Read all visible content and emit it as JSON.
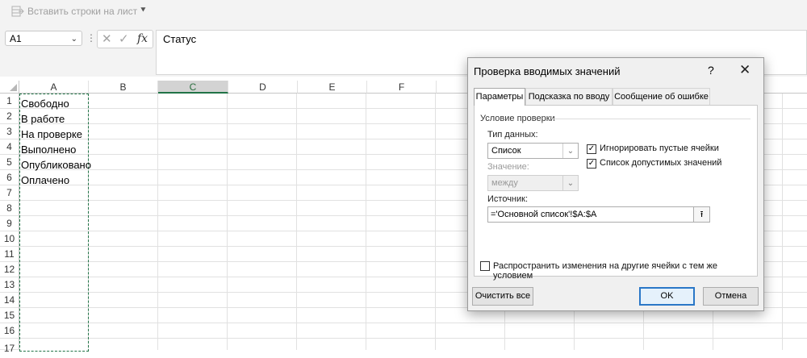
{
  "ribbon": {
    "insert_rows_label": "Вставить строки на лист",
    "more_icon": "chevron-down-icon"
  },
  "formula_bar": {
    "name_box": "A1",
    "cancel_icon": "✕",
    "enter_icon": "✓",
    "fx_label": "fx",
    "formula": "Статус"
  },
  "columns": [
    "A",
    "B",
    "C",
    "D",
    "E",
    "F"
  ],
  "selected_column": "C",
  "rows": [
    "1",
    "2",
    "3",
    "4",
    "5",
    "6",
    "7",
    "8",
    "9",
    "10",
    "11",
    "12",
    "13",
    "14",
    "15",
    "16",
    "17"
  ],
  "cells_a": [
    "Свободно",
    "В работе",
    "На проверке",
    "Выполнено",
    "Опубликовано",
    "Оплачено"
  ],
  "dialog": {
    "title": "Проверка вводимых значений",
    "help": "?",
    "close": "✕",
    "tabs": [
      "Параметры",
      "Подсказка по вводу",
      "Сообщение об ошибке"
    ],
    "active_tab": "Параметры",
    "group_label": "Условие проверки",
    "data_type_label": "Тип данных:",
    "data_type_value": "Список",
    "value_label": "Значение:",
    "value_value": "между",
    "ignore_blank_label": "Игнорировать пустые ячейки",
    "ignore_blank_checked": true,
    "dropdown_label": "Список допустимых значений",
    "dropdown_checked": true,
    "source_label": "Источник:",
    "source_value": "='Основной список'!$A:$A",
    "apply_all_label": "Распространить изменения на другие ячейки с тем же условием",
    "apply_all_checked": false,
    "clear_all_label": "Очистить все",
    "ok_label": "OK",
    "cancel_label": "Отмена"
  }
}
